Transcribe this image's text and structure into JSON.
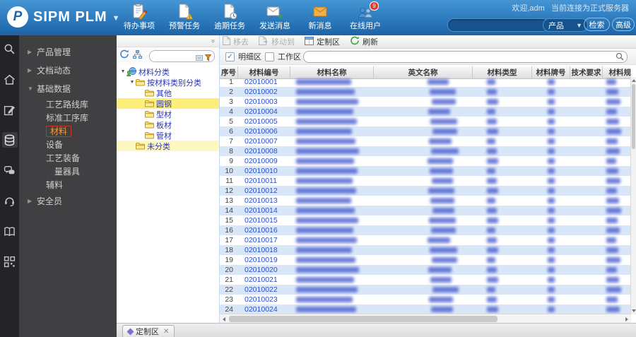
{
  "header": {
    "logo_text": "SIPM PLM",
    "welcome": "欢迎,adm",
    "server": "当前连接为正式服务器",
    "toolbar": [
      {
        "name": "todo-tasks",
        "label": "待办事项"
      },
      {
        "name": "alert-tasks",
        "label": "预警任务"
      },
      {
        "name": "overdue-tasks",
        "label": "逾期任务"
      },
      {
        "name": "send-message",
        "label": "发送消息"
      },
      {
        "name": "new-message",
        "label": "新消息"
      },
      {
        "name": "online-users",
        "label": "在线用户",
        "badge": "9"
      }
    ],
    "search": {
      "value": "",
      "category": "产品",
      "search_label": "检索",
      "advanced_label": "高级"
    },
    "colors": {
      "header_blue": "#2d7abc",
      "badge_red": "#e23b2e"
    }
  },
  "sidebar_icons": [
    {
      "name": "search"
    },
    {
      "name": "home"
    },
    {
      "name": "edit"
    },
    {
      "name": "database",
      "active": true
    },
    {
      "name": "messages"
    },
    {
      "name": "support"
    },
    {
      "name": "library"
    },
    {
      "name": "qrcode"
    }
  ],
  "nav": {
    "items": [
      {
        "label": "产品管理",
        "level": 0,
        "arrow": "collapsed"
      },
      {
        "label": "文档动态",
        "level": 0,
        "arrow": "collapsed"
      },
      {
        "label": "基础数据",
        "level": 0,
        "arrow": "expanded"
      },
      {
        "label": "工艺路线库",
        "level": 1
      },
      {
        "label": "标准工序库",
        "level": 1
      },
      {
        "label": "材料",
        "level": 1,
        "active": true
      },
      {
        "label": "设备",
        "level": 1
      },
      {
        "label": "工艺装备",
        "level": 1
      },
      {
        "label": "量器具",
        "level": 2
      },
      {
        "label": "辅料",
        "level": 1
      },
      {
        "label": "安全员",
        "level": 0
      }
    ],
    "active_color": "#f29b38"
  },
  "tree": {
    "nodes": [
      {
        "label": "材料分类",
        "level": 0,
        "type": "root",
        "expanded": true
      },
      {
        "label": "按材料类别分类",
        "level": 1,
        "type": "folder",
        "expanded": true
      },
      {
        "label": "其他",
        "level": 2,
        "type": "folder"
      },
      {
        "label": "圆钢",
        "level": 2,
        "type": "folder",
        "selected": true
      },
      {
        "label": "型材",
        "level": 2,
        "type": "folder"
      },
      {
        "label": "板材",
        "level": 2,
        "type": "folder"
      },
      {
        "label": "管材",
        "level": 2,
        "type": "folder"
      },
      {
        "label": "未分类",
        "level": 1,
        "type": "folder",
        "highlight": true
      }
    ],
    "selected_color": "#fcee79"
  },
  "toolbar": {
    "remove": "移去",
    "move_to": "移动到",
    "customize": "定制区",
    "refresh": "刷新"
  },
  "filters": {
    "detail_label": "明细区",
    "detail_checked": true,
    "work_label": "工作区",
    "work_checked": false
  },
  "table": {
    "columns": [
      "序号",
      "材料编号",
      "材料名称",
      "英文名称",
      "材料类型",
      "材料牌号",
      "技术要求",
      "材料规格"
    ],
    "rows": [
      {
        "no": "1",
        "code": "02010001"
      },
      {
        "no": "2",
        "code": "02010002"
      },
      {
        "no": "3",
        "code": "02010003"
      },
      {
        "no": "4",
        "code": "02010004"
      },
      {
        "no": "5",
        "code": "02010005"
      },
      {
        "no": "6",
        "code": "02010006"
      },
      {
        "no": "7",
        "code": "02010007"
      },
      {
        "no": "8",
        "code": "02010008"
      },
      {
        "no": "9",
        "code": "02010009"
      },
      {
        "no": "10",
        "code": "02010010"
      },
      {
        "no": "11",
        "code": "02010011"
      },
      {
        "no": "12",
        "code": "02010012"
      },
      {
        "no": "13",
        "code": "02010013"
      },
      {
        "no": "14",
        "code": "02010014"
      },
      {
        "no": "15",
        "code": "02010015"
      },
      {
        "no": "16",
        "code": "02010016"
      },
      {
        "no": "17",
        "code": "02010017"
      },
      {
        "no": "18",
        "code": "02010018"
      },
      {
        "no": "19",
        "code": "02010019"
      },
      {
        "no": "20",
        "code": "02010020"
      },
      {
        "no": "21",
        "code": "02010021"
      },
      {
        "no": "22",
        "code": "02010022"
      },
      {
        "no": "23",
        "code": "02010023"
      },
      {
        "no": "24",
        "code": "02010024"
      }
    ],
    "redacted_columns": [
      "材料名称",
      "英文名称",
      "材料类型",
      "材料牌号",
      "材料规格"
    ],
    "link_color": "#2b50c8",
    "stripe_color": "#d9e6f8"
  },
  "bottom": {
    "customize_tab": "定制区"
  }
}
